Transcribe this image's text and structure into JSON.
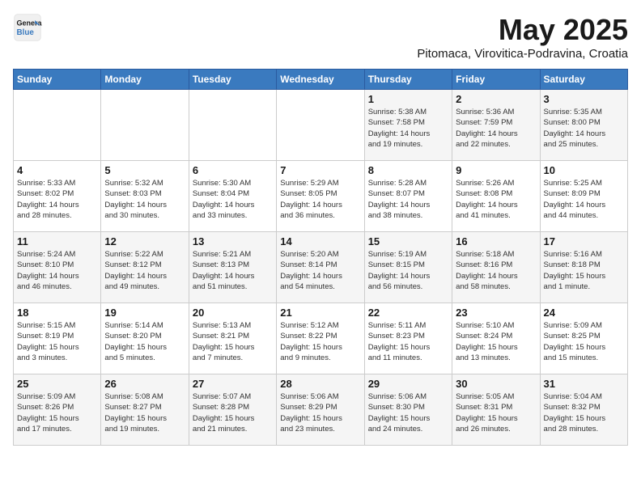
{
  "logo": {
    "line1": "General",
    "line2": "Blue"
  },
  "title": "May 2025",
  "subtitle": "Pitomaca, Virovitica-Podravina, Croatia",
  "days_of_week": [
    "Sunday",
    "Monday",
    "Tuesday",
    "Wednesday",
    "Thursday",
    "Friday",
    "Saturday"
  ],
  "weeks": [
    [
      {
        "day": "",
        "content": ""
      },
      {
        "day": "",
        "content": ""
      },
      {
        "day": "",
        "content": ""
      },
      {
        "day": "",
        "content": ""
      },
      {
        "day": "1",
        "content": "Sunrise: 5:38 AM\nSunset: 7:58 PM\nDaylight: 14 hours\nand 19 minutes."
      },
      {
        "day": "2",
        "content": "Sunrise: 5:36 AM\nSunset: 7:59 PM\nDaylight: 14 hours\nand 22 minutes."
      },
      {
        "day": "3",
        "content": "Sunrise: 5:35 AM\nSunset: 8:00 PM\nDaylight: 14 hours\nand 25 minutes."
      }
    ],
    [
      {
        "day": "4",
        "content": "Sunrise: 5:33 AM\nSunset: 8:02 PM\nDaylight: 14 hours\nand 28 minutes."
      },
      {
        "day": "5",
        "content": "Sunrise: 5:32 AM\nSunset: 8:03 PM\nDaylight: 14 hours\nand 30 minutes."
      },
      {
        "day": "6",
        "content": "Sunrise: 5:30 AM\nSunset: 8:04 PM\nDaylight: 14 hours\nand 33 minutes."
      },
      {
        "day": "7",
        "content": "Sunrise: 5:29 AM\nSunset: 8:05 PM\nDaylight: 14 hours\nand 36 minutes."
      },
      {
        "day": "8",
        "content": "Sunrise: 5:28 AM\nSunset: 8:07 PM\nDaylight: 14 hours\nand 38 minutes."
      },
      {
        "day": "9",
        "content": "Sunrise: 5:26 AM\nSunset: 8:08 PM\nDaylight: 14 hours\nand 41 minutes."
      },
      {
        "day": "10",
        "content": "Sunrise: 5:25 AM\nSunset: 8:09 PM\nDaylight: 14 hours\nand 44 minutes."
      }
    ],
    [
      {
        "day": "11",
        "content": "Sunrise: 5:24 AM\nSunset: 8:10 PM\nDaylight: 14 hours\nand 46 minutes."
      },
      {
        "day": "12",
        "content": "Sunrise: 5:22 AM\nSunset: 8:12 PM\nDaylight: 14 hours\nand 49 minutes."
      },
      {
        "day": "13",
        "content": "Sunrise: 5:21 AM\nSunset: 8:13 PM\nDaylight: 14 hours\nand 51 minutes."
      },
      {
        "day": "14",
        "content": "Sunrise: 5:20 AM\nSunset: 8:14 PM\nDaylight: 14 hours\nand 54 minutes."
      },
      {
        "day": "15",
        "content": "Sunrise: 5:19 AM\nSunset: 8:15 PM\nDaylight: 14 hours\nand 56 minutes."
      },
      {
        "day": "16",
        "content": "Sunrise: 5:18 AM\nSunset: 8:16 PM\nDaylight: 14 hours\nand 58 minutes."
      },
      {
        "day": "17",
        "content": "Sunrise: 5:16 AM\nSunset: 8:18 PM\nDaylight: 15 hours\nand 1 minute."
      }
    ],
    [
      {
        "day": "18",
        "content": "Sunrise: 5:15 AM\nSunset: 8:19 PM\nDaylight: 15 hours\nand 3 minutes."
      },
      {
        "day": "19",
        "content": "Sunrise: 5:14 AM\nSunset: 8:20 PM\nDaylight: 15 hours\nand 5 minutes."
      },
      {
        "day": "20",
        "content": "Sunrise: 5:13 AM\nSunset: 8:21 PM\nDaylight: 15 hours\nand 7 minutes."
      },
      {
        "day": "21",
        "content": "Sunrise: 5:12 AM\nSunset: 8:22 PM\nDaylight: 15 hours\nand 9 minutes."
      },
      {
        "day": "22",
        "content": "Sunrise: 5:11 AM\nSunset: 8:23 PM\nDaylight: 15 hours\nand 11 minutes."
      },
      {
        "day": "23",
        "content": "Sunrise: 5:10 AM\nSunset: 8:24 PM\nDaylight: 15 hours\nand 13 minutes."
      },
      {
        "day": "24",
        "content": "Sunrise: 5:09 AM\nSunset: 8:25 PM\nDaylight: 15 hours\nand 15 minutes."
      }
    ],
    [
      {
        "day": "25",
        "content": "Sunrise: 5:09 AM\nSunset: 8:26 PM\nDaylight: 15 hours\nand 17 minutes."
      },
      {
        "day": "26",
        "content": "Sunrise: 5:08 AM\nSunset: 8:27 PM\nDaylight: 15 hours\nand 19 minutes."
      },
      {
        "day": "27",
        "content": "Sunrise: 5:07 AM\nSunset: 8:28 PM\nDaylight: 15 hours\nand 21 minutes."
      },
      {
        "day": "28",
        "content": "Sunrise: 5:06 AM\nSunset: 8:29 PM\nDaylight: 15 hours\nand 23 minutes."
      },
      {
        "day": "29",
        "content": "Sunrise: 5:06 AM\nSunset: 8:30 PM\nDaylight: 15 hours\nand 24 minutes."
      },
      {
        "day": "30",
        "content": "Sunrise: 5:05 AM\nSunset: 8:31 PM\nDaylight: 15 hours\nand 26 minutes."
      },
      {
        "day": "31",
        "content": "Sunrise: 5:04 AM\nSunset: 8:32 PM\nDaylight: 15 hours\nand 28 minutes."
      }
    ]
  ]
}
